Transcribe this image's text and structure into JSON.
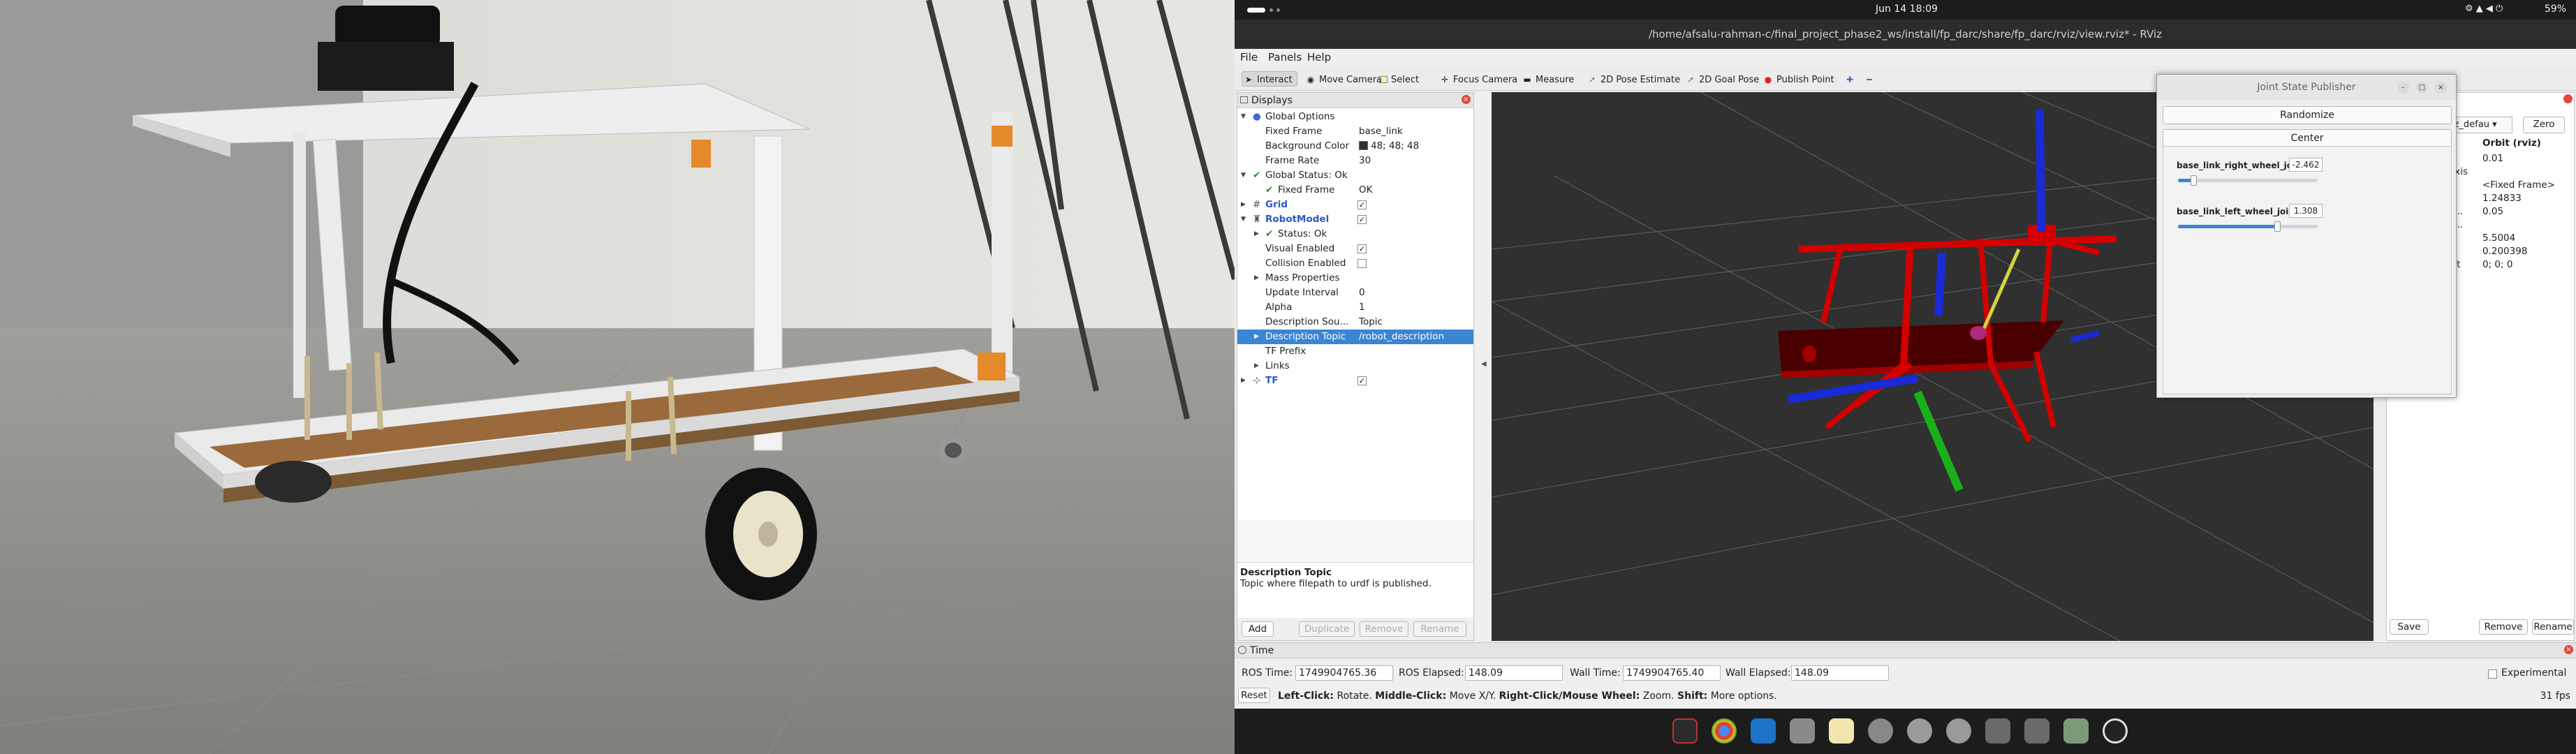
{
  "photo": {
    "description_icon": "robot-chassis-photo"
  },
  "topbar": {
    "clock": "Jun 14  18:09",
    "battery": "59%"
  },
  "window": {
    "title": "/home/afsalu-rahman-c/final_project_phase2_ws/install/fp_darc/share/fp_darc/rviz/view.rviz* - RViz"
  },
  "menu": [
    "File",
    "Panels",
    "Help"
  ],
  "toolbar": {
    "interact": "Interact",
    "move_camera": "Move Camera",
    "select": "Select",
    "focus_camera": "Focus Camera",
    "measure": "Measure",
    "pose_estimate": "2D Pose Estimate",
    "goal_pose": "2D Goal Pose",
    "publish_point": "Publish Point"
  },
  "displays": {
    "title": "Displays",
    "rows": {
      "global_options": "Global Options",
      "fixed_frame_k": "Fixed Frame",
      "fixed_frame_v": "base_link",
      "bg_color_k": "Background Color",
      "bg_color_v": "48; 48; 48",
      "frame_rate_k": "Frame Rate",
      "frame_rate_v": "30",
      "global_status": "Global Status: Ok",
      "gs_fixed_frame_k": "Fixed Frame",
      "gs_fixed_frame_v": "OK",
      "grid": "Grid",
      "robot_model": "RobotModel",
      "status_ok": "Status: Ok",
      "visual_enabled": "Visual Enabled",
      "collision_enabled": "Collision Enabled",
      "mass_properties": "Mass Properties",
      "update_interval_k": "Update Interval",
      "update_interval_v": "0",
      "alpha_k": "Alpha",
      "alpha_v": "1",
      "desc_source_k": "Description Sou...",
      "desc_source_v": "Topic",
      "desc_topic_k": "Description Topic",
      "desc_topic_v": "/robot_description",
      "tf_prefix": "TF Prefix",
      "links": "Links",
      "tf": "TF"
    },
    "help_title": "Description Topic",
    "help_text": "Topic where filepath to urdf is published.",
    "buttons": {
      "add": "Add",
      "duplicate": "Duplicate",
      "remove": "Remove",
      "rename": "Rename"
    }
  },
  "views": {
    "type_value": "iz_defau",
    "zero": "Zero",
    "col_view": "w",
    "col_orbit": "Orbit (rviz)",
    "rows": [
      {
        "k": "",
        "v": "0.01"
      },
      {
        "k": "Axis",
        "v": ""
      },
      {
        "k": "",
        "v": "<Fixed Frame>"
      },
      {
        "k": "",
        "v": "1.24833"
      },
      {
        "k": "p...",
        "v": "0.05"
      },
      {
        "k": "p...",
        "v": ""
      },
      {
        "k": "",
        "v": "5.5004"
      },
      {
        "k": "",
        "v": "0.200398"
      },
      {
        "k": "int",
        "v": "0; 0; 0"
      }
    ],
    "buttons": {
      "save": "Save",
      "remove": "Remove",
      "rename": "Rename"
    }
  },
  "jsp": {
    "title": "Joint State Publisher",
    "randomize": "Randomize",
    "center": "Center",
    "joints": [
      {
        "name": "base_link_right_wheel_joint",
        "value": "-2.462",
        "level": 0.11
      },
      {
        "name": "base_link_left_wheel_joint",
        "value": "1.308",
        "level": 0.71
      }
    ]
  },
  "time": {
    "title": "Time",
    "ros_time_label": "ROS Time:",
    "ros_time": "1749904765.36",
    "ros_elapsed_label": "ROS Elapsed:",
    "ros_elapsed": "148.09",
    "wall_time_label": "Wall Time:",
    "wall_time": "1749904765.40",
    "wall_elapsed_label": "Wall Elapsed:",
    "wall_elapsed": "148.09",
    "experimental": "Experimental",
    "reset": "Reset",
    "hint_1": "Left-Click:",
    "hint_2": " Rotate. ",
    "hint_3": "Middle-Click:",
    "hint_4": " Move X/Y. ",
    "hint_5": "Right-Click/Mouse Wheel:",
    "hint_6": " Zoom. ",
    "hint_7": "Shift:",
    "hint_8": " More options.",
    "fps": "31 fps"
  },
  "colors": {
    "accent": "#3a86d4",
    "viewport_bg": "#303030",
    "robot_red": "#d40000"
  }
}
